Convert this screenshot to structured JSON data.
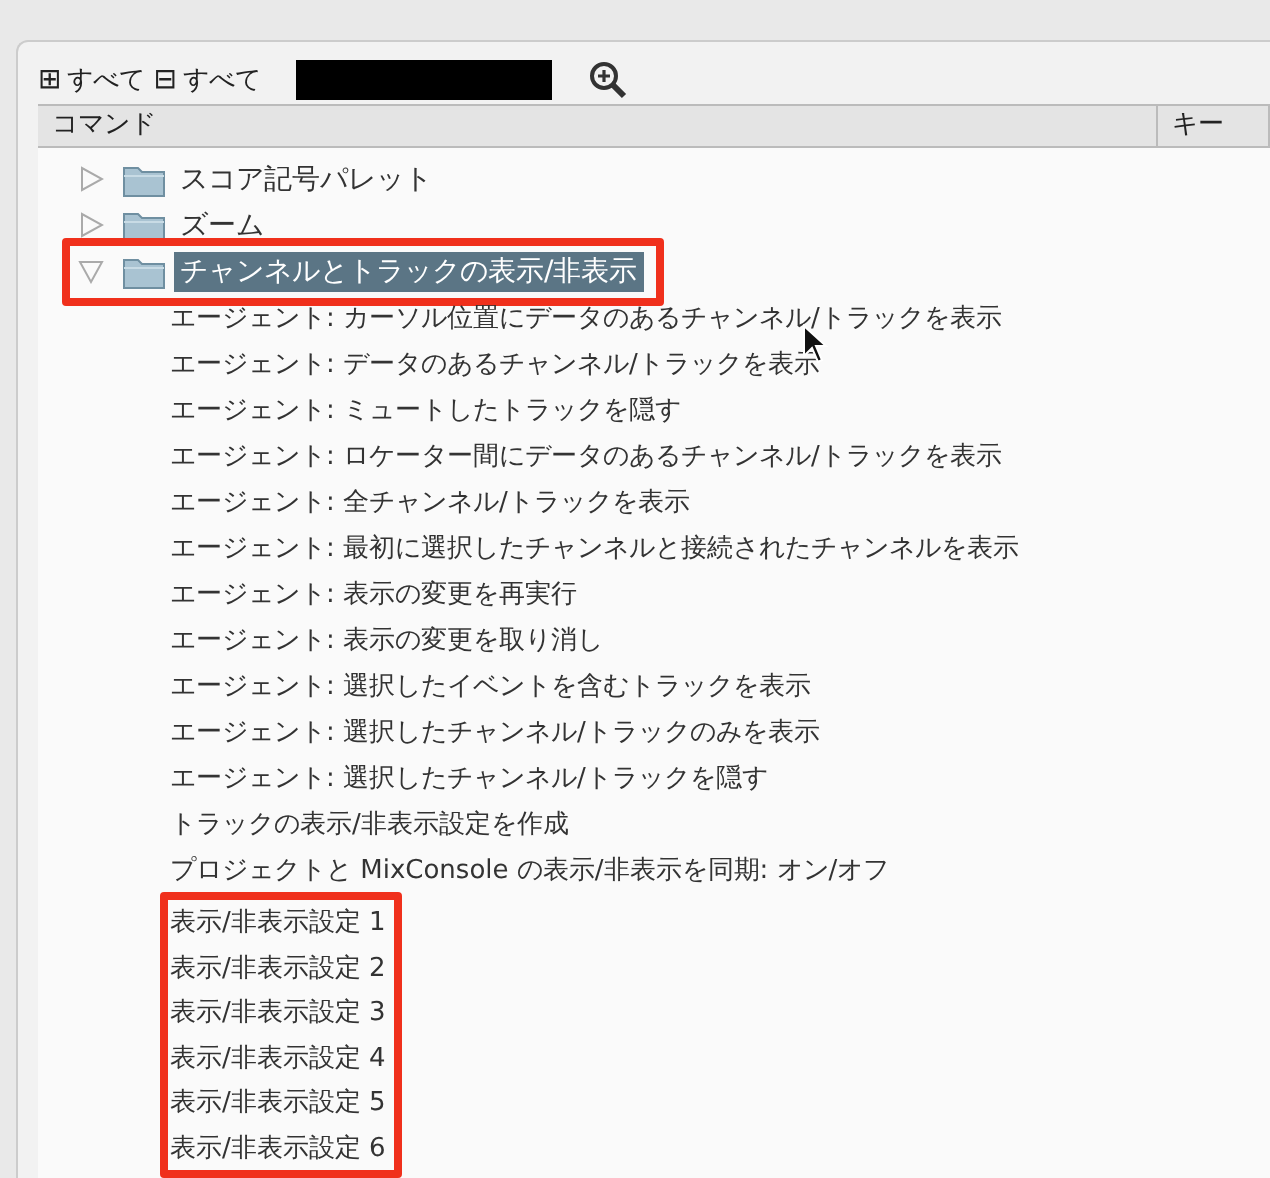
{
  "toolbar": {
    "expand_all": {
      "icon": "⊞",
      "label": "すべて"
    },
    "collapse_all": {
      "icon": "⊟",
      "label": "すべて"
    },
    "search": {
      "redacted": true
    }
  },
  "table": {
    "columns": [
      "コマンド",
      "キー"
    ],
    "folders": [
      {
        "label": "スコア記号パレット",
        "expanded": false,
        "selected": false,
        "highlighted": false
      },
      {
        "label": "ズーム",
        "expanded": false,
        "selected": false,
        "highlighted": false
      },
      {
        "label": "チャンネルとトラックの表示/非表示",
        "expanded": true,
        "selected": true,
        "highlighted": true,
        "children": [
          {
            "label": "エージェント: カーソル位置にデータのあるチャンネル/トラックを表示",
            "highlighted": false
          },
          {
            "label": "エージェント: データのあるチャンネル/トラックを表示",
            "highlighted": false
          },
          {
            "label": "エージェント: ミュートしたトラックを隠す",
            "highlighted": false
          },
          {
            "label": "エージェント: ロケーター間にデータのあるチャンネル/トラックを表示",
            "highlighted": false
          },
          {
            "label": "エージェント: 全チャンネル/トラックを表示",
            "highlighted": false
          },
          {
            "label": "エージェント: 最初に選択したチャンネルと接続されたチャンネルを表示",
            "highlighted": false
          },
          {
            "label": "エージェント: 表示の変更を再実行",
            "highlighted": false
          },
          {
            "label": "エージェント: 表示の変更を取り消し",
            "highlighted": false
          },
          {
            "label": "エージェント: 選択したイベントを含むトラックを表示",
            "highlighted": false
          },
          {
            "label": "エージェント: 選択したチャンネル/トラックのみを表示",
            "highlighted": false
          },
          {
            "label": "エージェント: 選択したチャンネル/トラックを隠す",
            "highlighted": false
          },
          {
            "label": "トラックの表示/非表示設定を作成",
            "highlighted": false
          },
          {
            "label": "プロジェクトと MixConsole の表示/非表示を同期: オン/オフ",
            "highlighted": false
          },
          {
            "label": "表示/非表示設定 1",
            "highlighted": true
          },
          {
            "label": "表示/非表示設定 2",
            "highlighted": true
          },
          {
            "label": "表示/非表示設定 3",
            "highlighted": true
          },
          {
            "label": "表示/非表示設定 4",
            "highlighted": true
          },
          {
            "label": "表示/非表示設定 5",
            "highlighted": true
          },
          {
            "label": "表示/非表示設定 6",
            "highlighted": true
          }
        ]
      }
    ]
  }
}
